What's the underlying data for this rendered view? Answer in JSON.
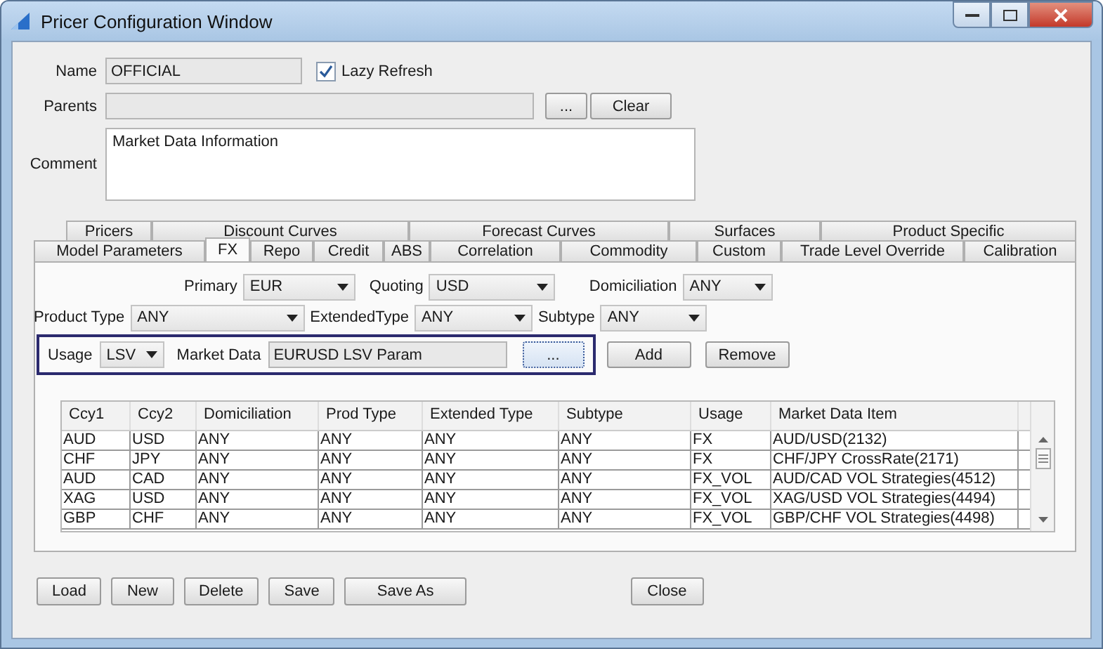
{
  "window": {
    "title": "Pricer Configuration Window"
  },
  "form": {
    "name_label": "Name",
    "name_value": "OFFICIAL",
    "lazy_refresh": {
      "label": "Lazy Refresh",
      "checked": true
    },
    "parents_label": "Parents",
    "parents_browse": "...",
    "parents_clear": "Clear",
    "comment_label": "Comment",
    "comment_value": "Market Data Information"
  },
  "tab_rows": [
    [
      {
        "label": "Pricers",
        "selected": false
      },
      {
        "label": "Discount Curves",
        "selected": false
      },
      {
        "label": "Forecast Curves",
        "selected": false
      },
      {
        "label": "Surfaces",
        "selected": false
      },
      {
        "label": "Product Specific",
        "selected": false
      }
    ],
    [
      {
        "label": "Model Parameters",
        "selected": false
      },
      {
        "label": "FX",
        "selected": true
      },
      {
        "label": "Repo",
        "selected": false
      },
      {
        "label": "Credit",
        "selected": false
      },
      {
        "label": "ABS",
        "selected": false
      },
      {
        "label": "Correlation",
        "selected": false
      },
      {
        "label": "Commodity",
        "selected": false
      },
      {
        "label": "Custom",
        "selected": false
      },
      {
        "label": "Trade Level Override",
        "selected": false
      },
      {
        "label": "Calibration",
        "selected": false
      }
    ]
  ],
  "filters": {
    "primary": {
      "label": "Primary",
      "value": "EUR"
    },
    "quoting": {
      "label": "Quoting",
      "value": "USD"
    },
    "domiciliation": {
      "label": "Domiciliation",
      "value": "ANY"
    },
    "product_type": {
      "label": "Product Type",
      "value": "ANY"
    },
    "extended_type": {
      "label": "ExtendedType",
      "value": "ANY"
    },
    "subtype": {
      "label": "Subtype",
      "value": "ANY"
    }
  },
  "usage_row": {
    "usage_label": "Usage",
    "usage_value": "LSV",
    "market_data_label": "Market Data",
    "market_data_value": "EURUSD LSV Param",
    "browse": "...",
    "add": "Add",
    "remove": "Remove"
  },
  "table": {
    "columns": [
      "Ccy1",
      "Ccy2",
      "Domiciliation",
      "Prod Type",
      "Extended Type",
      "Subtype",
      "Usage",
      "Market Data Item"
    ],
    "rows": [
      [
        "AUD",
        "USD",
        "ANY",
        "ANY",
        "ANY",
        "ANY",
        "FX",
        "AUD/USD(2132)"
      ],
      [
        "CHF",
        "JPY",
        "ANY",
        "ANY",
        "ANY",
        "ANY",
        "FX",
        "CHF/JPY CrossRate(2171)"
      ],
      [
        "AUD",
        "CAD",
        "ANY",
        "ANY",
        "ANY",
        "ANY",
        "FX_VOL",
        "AUD/CAD VOL Strategies(4512)"
      ],
      [
        "XAG",
        "USD",
        "ANY",
        "ANY",
        "ANY",
        "ANY",
        "FX_VOL",
        "XAG/USD VOL Strategies(4494)"
      ],
      [
        "GBP",
        "CHF",
        "ANY",
        "ANY",
        "ANY",
        "ANY",
        "FX_VOL",
        "GBP/CHF VOL Strategies(4498)"
      ]
    ]
  },
  "buttons": [
    "Load",
    "New",
    "Delete",
    "Save",
    "Save As"
  ],
  "close_button": "Close"
}
